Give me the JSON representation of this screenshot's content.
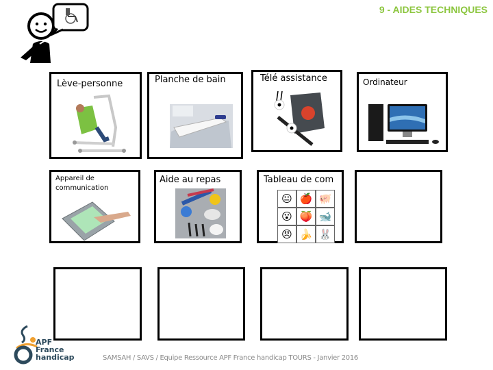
{
  "header": {
    "title": "9 - AIDES TECHNIQUES",
    "title_color": "#8cc63f"
  },
  "pictogram": {
    "person_icon": "person-pointing-self-icon",
    "bubble_icon": "wheelchair-icon"
  },
  "cards": [
    {
      "label": "Lève-personne",
      "image": "patient-lift-icon"
    },
    {
      "label": "Planche de bain",
      "image": "bath-board-icon"
    },
    {
      "label": "Télé assistance",
      "image": "emergency-alarm-icon"
    },
    {
      "label": "Ordinateur",
      "image": "desktop-computer-icon"
    },
    {
      "label": "Appareil de communication",
      "image": "communication-tablet-icon"
    },
    {
      "label": "Aide au repas",
      "image": "eating-aids-icon"
    },
    {
      "label": "Tableau de com",
      "image": "communication-board-icon"
    },
    {
      "label": "",
      "image": ""
    },
    {
      "label": "",
      "image": ""
    },
    {
      "label": "",
      "image": ""
    },
    {
      "label": "",
      "image": ""
    },
    {
      "label": "",
      "image": ""
    }
  ],
  "communication_board": {
    "cells": [
      "😐",
      "🍎",
      "🐖",
      "😮",
      "🍑",
      "🐋",
      "😠",
      "🍌",
      "🐰"
    ]
  },
  "logo": {
    "line1": "APF",
    "line2": "France",
    "line3": "handicap"
  },
  "footer": {
    "text": "SAMSAH / SAVS / Equipe Ressource APF France handicap TOURS - Janvier 2016"
  }
}
